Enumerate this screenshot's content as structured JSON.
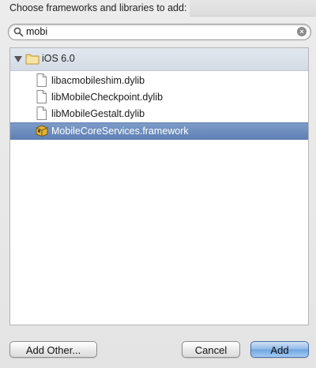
{
  "dialog": {
    "title": "Choose frameworks and libraries to add:"
  },
  "search": {
    "value": "mobi",
    "placeholder": ""
  },
  "tree": {
    "group": {
      "label": "iOS 6.0",
      "expanded": true
    },
    "items": [
      {
        "label": "libacmobileshim.dylib",
        "icon": "document-icon",
        "selected": false
      },
      {
        "label": "libMobileCheckpoint.dylib",
        "icon": "document-icon",
        "selected": false
      },
      {
        "label": "libMobileGestalt.dylib",
        "icon": "document-icon",
        "selected": false
      },
      {
        "label": "MobileCoreServices.framework",
        "icon": "framework-icon",
        "selected": true
      }
    ]
  },
  "buttons": {
    "add_other": "Add Other...",
    "cancel": "Cancel",
    "add": "Add"
  },
  "colors": {
    "selection": "#6a8abd",
    "default_button": "#8fb8e8"
  }
}
